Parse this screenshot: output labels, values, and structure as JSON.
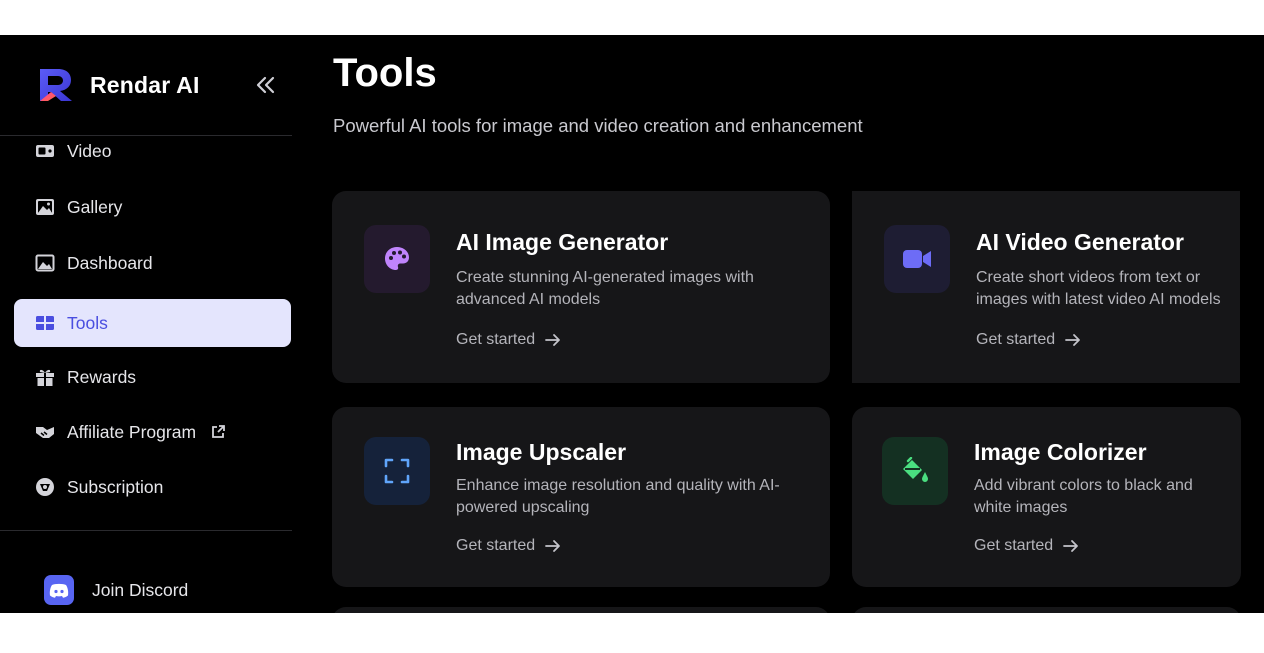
{
  "brand": {
    "name": "Rendar AI",
    "logo_icon": "rendar-logo-icon",
    "collapse_icon": "chevrons-left-icon"
  },
  "nav": {
    "items": [
      {
        "label": "Video",
        "icon": "video-camera-icon"
      },
      {
        "label": "Gallery",
        "icon": "image-icon"
      },
      {
        "label": "Dashboard",
        "icon": "landscape-icon"
      },
      {
        "label": "Tools",
        "icon": "grid-icon",
        "active": true
      },
      {
        "label": "Rewards",
        "icon": "gift-icon"
      },
      {
        "label": "Affiliate Program",
        "icon": "handshake-icon",
        "external_icon": "external-link-icon"
      },
      {
        "label": "Subscription",
        "icon": "subscription-icon"
      }
    ],
    "discord": {
      "label": "Join Discord",
      "icon": "discord-icon"
    }
  },
  "page": {
    "title": "Tools",
    "subtitle": "Powerful AI tools for image and video creation and enhancement"
  },
  "tools": [
    {
      "title": "AI Image Generator",
      "description": "Create stunning AI-generated images with advanced AI models",
      "cta": "Get started",
      "icon": "palette-icon",
      "icon_color": "#c084fc",
      "icon_bg": "#241a2e"
    },
    {
      "title": "AI Video Generator",
      "description": "Create short videos from text or images with latest video AI models",
      "cta": "Get started",
      "icon": "video-icon",
      "icon_color": "#6d6cf6",
      "icon_bg": "#1e1d33"
    },
    {
      "title": "Image Upscaler",
      "description": "Enhance image resolution and quality with AI-powered upscaling",
      "cta": "Get started",
      "icon": "expand-icon",
      "icon_color": "#60a5fa",
      "icon_bg": "#15223a"
    },
    {
      "title": "Image Colorizer",
      "description": "Add vibrant colors to black and white images",
      "cta": "Get started",
      "icon": "paint-bucket-icon",
      "icon_color": "#4ade80",
      "icon_bg": "#143022"
    }
  ],
  "colors": {
    "accent": "#4a4ee0",
    "active_bg": "#e4e5fd",
    "card_bg": "#161618",
    "discord": "#5865f2"
  }
}
